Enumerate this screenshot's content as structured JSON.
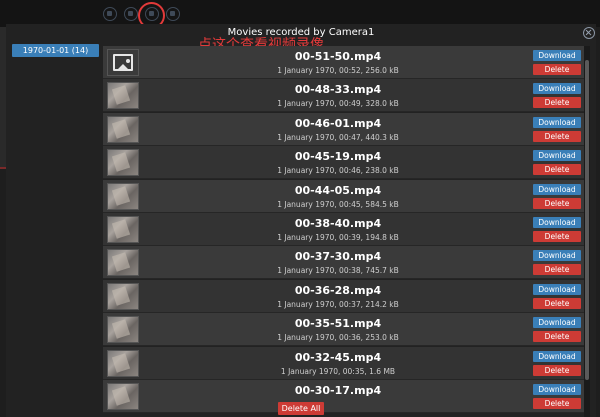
{
  "modal": {
    "title": "Movies recorded by Camera1",
    "annotation": "点这个查看视频录像",
    "delete_all_label": "Delete All"
  },
  "sidebar": {
    "dates": [
      {
        "label": "1970-01-01 (14)"
      }
    ]
  },
  "buttons": {
    "download": "Download",
    "delete": "Delete"
  },
  "movies": [
    {
      "name": "00-51-50.mp4",
      "meta": "1 January 1970, 00:52, 256.0 kB",
      "thumb": "image-placeholder-icon"
    },
    {
      "name": "00-48-33.mp4",
      "meta": "1 January 1970, 00:49, 328.0 kB",
      "thumb": "video-thumbnail"
    },
    {
      "name": "00-46-01.mp4",
      "meta": "1 January 1970, 00:47, 440.3 kB",
      "thumb": "video-thumbnail"
    },
    {
      "name": "00-45-19.mp4",
      "meta": "1 January 1970, 00:46, 238.0 kB",
      "thumb": "video-thumbnail"
    },
    {
      "name": "00-44-05.mp4",
      "meta": "1 January 1970, 00:45, 584.5 kB",
      "thumb": "video-thumbnail"
    },
    {
      "name": "00-38-40.mp4",
      "meta": "1 January 1970, 00:39, 194.8 kB",
      "thumb": "video-thumbnail"
    },
    {
      "name": "00-37-30.mp4",
      "meta": "1 January 1970, 00:38, 745.7 kB",
      "thumb": "video-thumbnail"
    },
    {
      "name": "00-36-28.mp4",
      "meta": "1 January 1970, 00:37, 214.2 kB",
      "thumb": "video-thumbnail"
    },
    {
      "name": "00-35-51.mp4",
      "meta": "1 January 1970, 00:36, 253.0 kB",
      "thumb": "video-thumbnail"
    },
    {
      "name": "00-32-45.mp4",
      "meta": "1 January 1970, 00:35, 1.6 MB",
      "thumb": "video-thumbnail"
    },
    {
      "name": "00-30-17.mp4",
      "meta": "",
      "thumb": "video-thumbnail"
    }
  ],
  "colors": {
    "download": "#3a7fb8",
    "delete": "#cd3b35",
    "annotation": "#e23a3a"
  }
}
